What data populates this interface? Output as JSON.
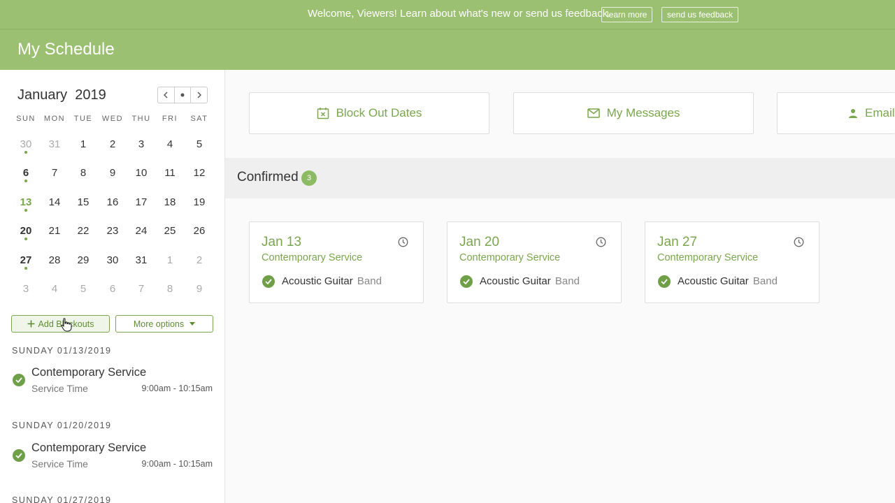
{
  "banner": {
    "message": "Welcome, Viewers! Learn about what's new or send us feedback.",
    "learn_more": "learn more",
    "send_feedback": "send us feedback"
  },
  "header": {
    "title": "My Schedule"
  },
  "calendar": {
    "month": "January",
    "year": "2019",
    "weekdays": [
      "SUN",
      "MON",
      "TUE",
      "WED",
      "THU",
      "FRI",
      "SAT"
    ],
    "weeks": [
      [
        "30",
        "31",
        "1",
        "2",
        "3",
        "4",
        "5"
      ],
      [
        "6",
        "7",
        "8",
        "9",
        "10",
        "11",
        "12"
      ],
      [
        "13",
        "14",
        "15",
        "16",
        "17",
        "18",
        "19"
      ],
      [
        "20",
        "21",
        "22",
        "23",
        "24",
        "25",
        "26"
      ],
      [
        "27",
        "28",
        "29",
        "30",
        "31",
        "1",
        "2"
      ],
      [
        "3",
        "4",
        "5",
        "6",
        "7",
        "8",
        "9"
      ]
    ]
  },
  "sidebar": {
    "add_blockouts": "Add Blockouts",
    "more_options": "More options",
    "events": [
      {
        "date": "SUNDAY 01/13/2019",
        "title": "Contemporary Service",
        "subtitle": "Service Time",
        "time": "9:00am - 10:15am"
      },
      {
        "date": "SUNDAY 01/20/2019",
        "title": "Contemporary Service",
        "subtitle": "Service Time",
        "time": "9:00am - 10:15am"
      },
      {
        "date": "SUNDAY 01/27/2019"
      }
    ]
  },
  "actions": {
    "block_out_dates": "Block Out Dates",
    "my_messages": "My Messages",
    "email": "Email"
  },
  "confirmed": {
    "label": "Confirmed",
    "count": "3",
    "cards": [
      {
        "date": "Jan 13",
        "service": "Contemporary Service",
        "role": "Acoustic Guitar",
        "team": "Band"
      },
      {
        "date": "Jan 20",
        "service": "Contemporary Service",
        "role": "Acoustic Guitar",
        "team": "Band"
      },
      {
        "date": "Jan 27",
        "service": "Contemporary Service",
        "role": "Acoustic Guitar",
        "team": "Band"
      }
    ]
  },
  "colors": {
    "brand_green": "#9cc071",
    "accent_green": "#7aa64d",
    "check_green": "#6fa048"
  }
}
